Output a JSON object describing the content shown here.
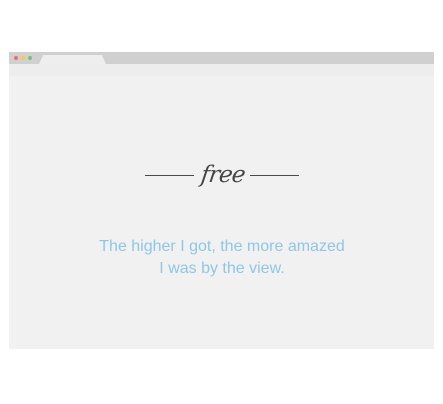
{
  "window": {
    "controls": [
      {
        "name": "close",
        "color": "#f46c68"
      },
      {
        "name": "minimize",
        "color": "#f6c94b"
      },
      {
        "name": "maximize",
        "color": "#72c86b"
      }
    ],
    "tab_color": "#eeeeee",
    "chrome_color": "#d0d0d0",
    "page_background": "#f1f1f1"
  },
  "content": {
    "heading": "free",
    "heading_color": "#444444",
    "quote": "The higher I got, the more amazed\nI was by the view.",
    "quote_color": "#8ec7e6"
  }
}
